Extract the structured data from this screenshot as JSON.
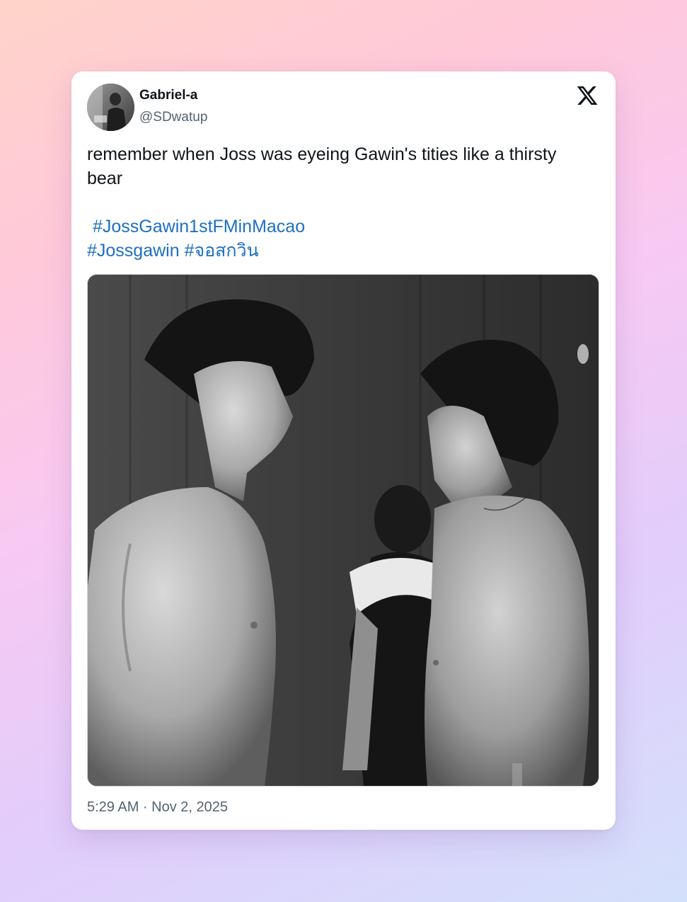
{
  "user": {
    "display_name": "Gabriel-a",
    "handle": "@SDwatup"
  },
  "tweet": {
    "text": "remember when Joss was eyeing Gawin's tities like a thirsty bear",
    "hashtags_line1": "#JossGawin1stFMinMacao",
    "hashtags_line2": "#Jossgawin #จอสกวิน",
    "timestamp": "5:29 AM · Nov 2, 2025"
  },
  "icons": {
    "platform_logo": "x-logo-icon",
    "avatar": "avatar-photo"
  },
  "colors": {
    "link": "#1d6fc4",
    "text": "#0f1419",
    "muted": "#536471",
    "card": "#ffffff"
  }
}
